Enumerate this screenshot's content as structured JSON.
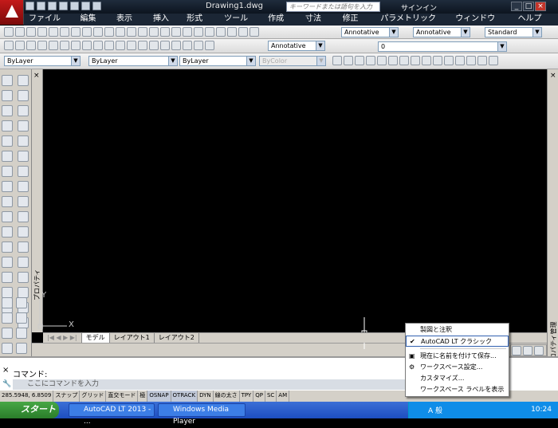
{
  "app": {
    "title": "Drawing1.dwg",
    "search_placeholder": "キーワードまたは語句を入力",
    "signin": "サインイン"
  },
  "menu": [
    "ファイル(F)",
    "編集(E)",
    "表示(V)",
    "挿入(I)",
    "形式(O)",
    "ツール(T)",
    "作成(D)",
    "寸法(N)",
    "修正(M)",
    "パラメトリック(P)",
    "ウィンドウ(W)",
    "ヘルプ(H)"
  ],
  "styles": {
    "text_style": "Annotative",
    "dim_style": "Annotative",
    "table_style": "Standard",
    "mleader_style": "Annotative",
    "layer": "0"
  },
  "properties": {
    "layer": "ByLayer",
    "linetype": "ByLayer",
    "lineweight": "ByLayer",
    "color": "ByColor"
  },
  "palettes": {
    "left_label": "プロパティ",
    "right_label": "図面プロパティ管理"
  },
  "tabs": [
    "モデル",
    "レイアウト1",
    "レイアウト2"
  ],
  "ucs": {
    "x_label": "X",
    "y_label": "Y"
  },
  "command": {
    "label": "コマンド:",
    "placeholder": "ここにコマンドを入力"
  },
  "status": {
    "coords": "285.5948, 6.8509",
    "toggles": [
      "スナップ",
      "グリッド",
      "直交モード",
      "極",
      "OSNAP",
      "OTRACK",
      "DYN",
      "線の太さ",
      "TPY",
      "QP",
      "SC",
      "AM"
    ]
  },
  "context_menu": {
    "items": [
      {
        "label": "製図と注釈",
        "checked": false
      },
      {
        "label": "AutoCAD LT クラシック",
        "checked": true
      },
      {
        "label": "現在に名前を付けて保存...",
        "checked": false
      },
      {
        "label": "ワークスペース設定...",
        "checked": false
      },
      {
        "label": "カスタマイズ...",
        "checked": false
      },
      {
        "label": "ワークスペース ラベルを表示",
        "checked": false
      }
    ]
  },
  "taskbar": {
    "start": "スタート",
    "tasks": [
      "AutoCAD LT 2013 - ...",
      "Windows Media Player"
    ],
    "ime": "A 般",
    "clock": "10:24"
  }
}
